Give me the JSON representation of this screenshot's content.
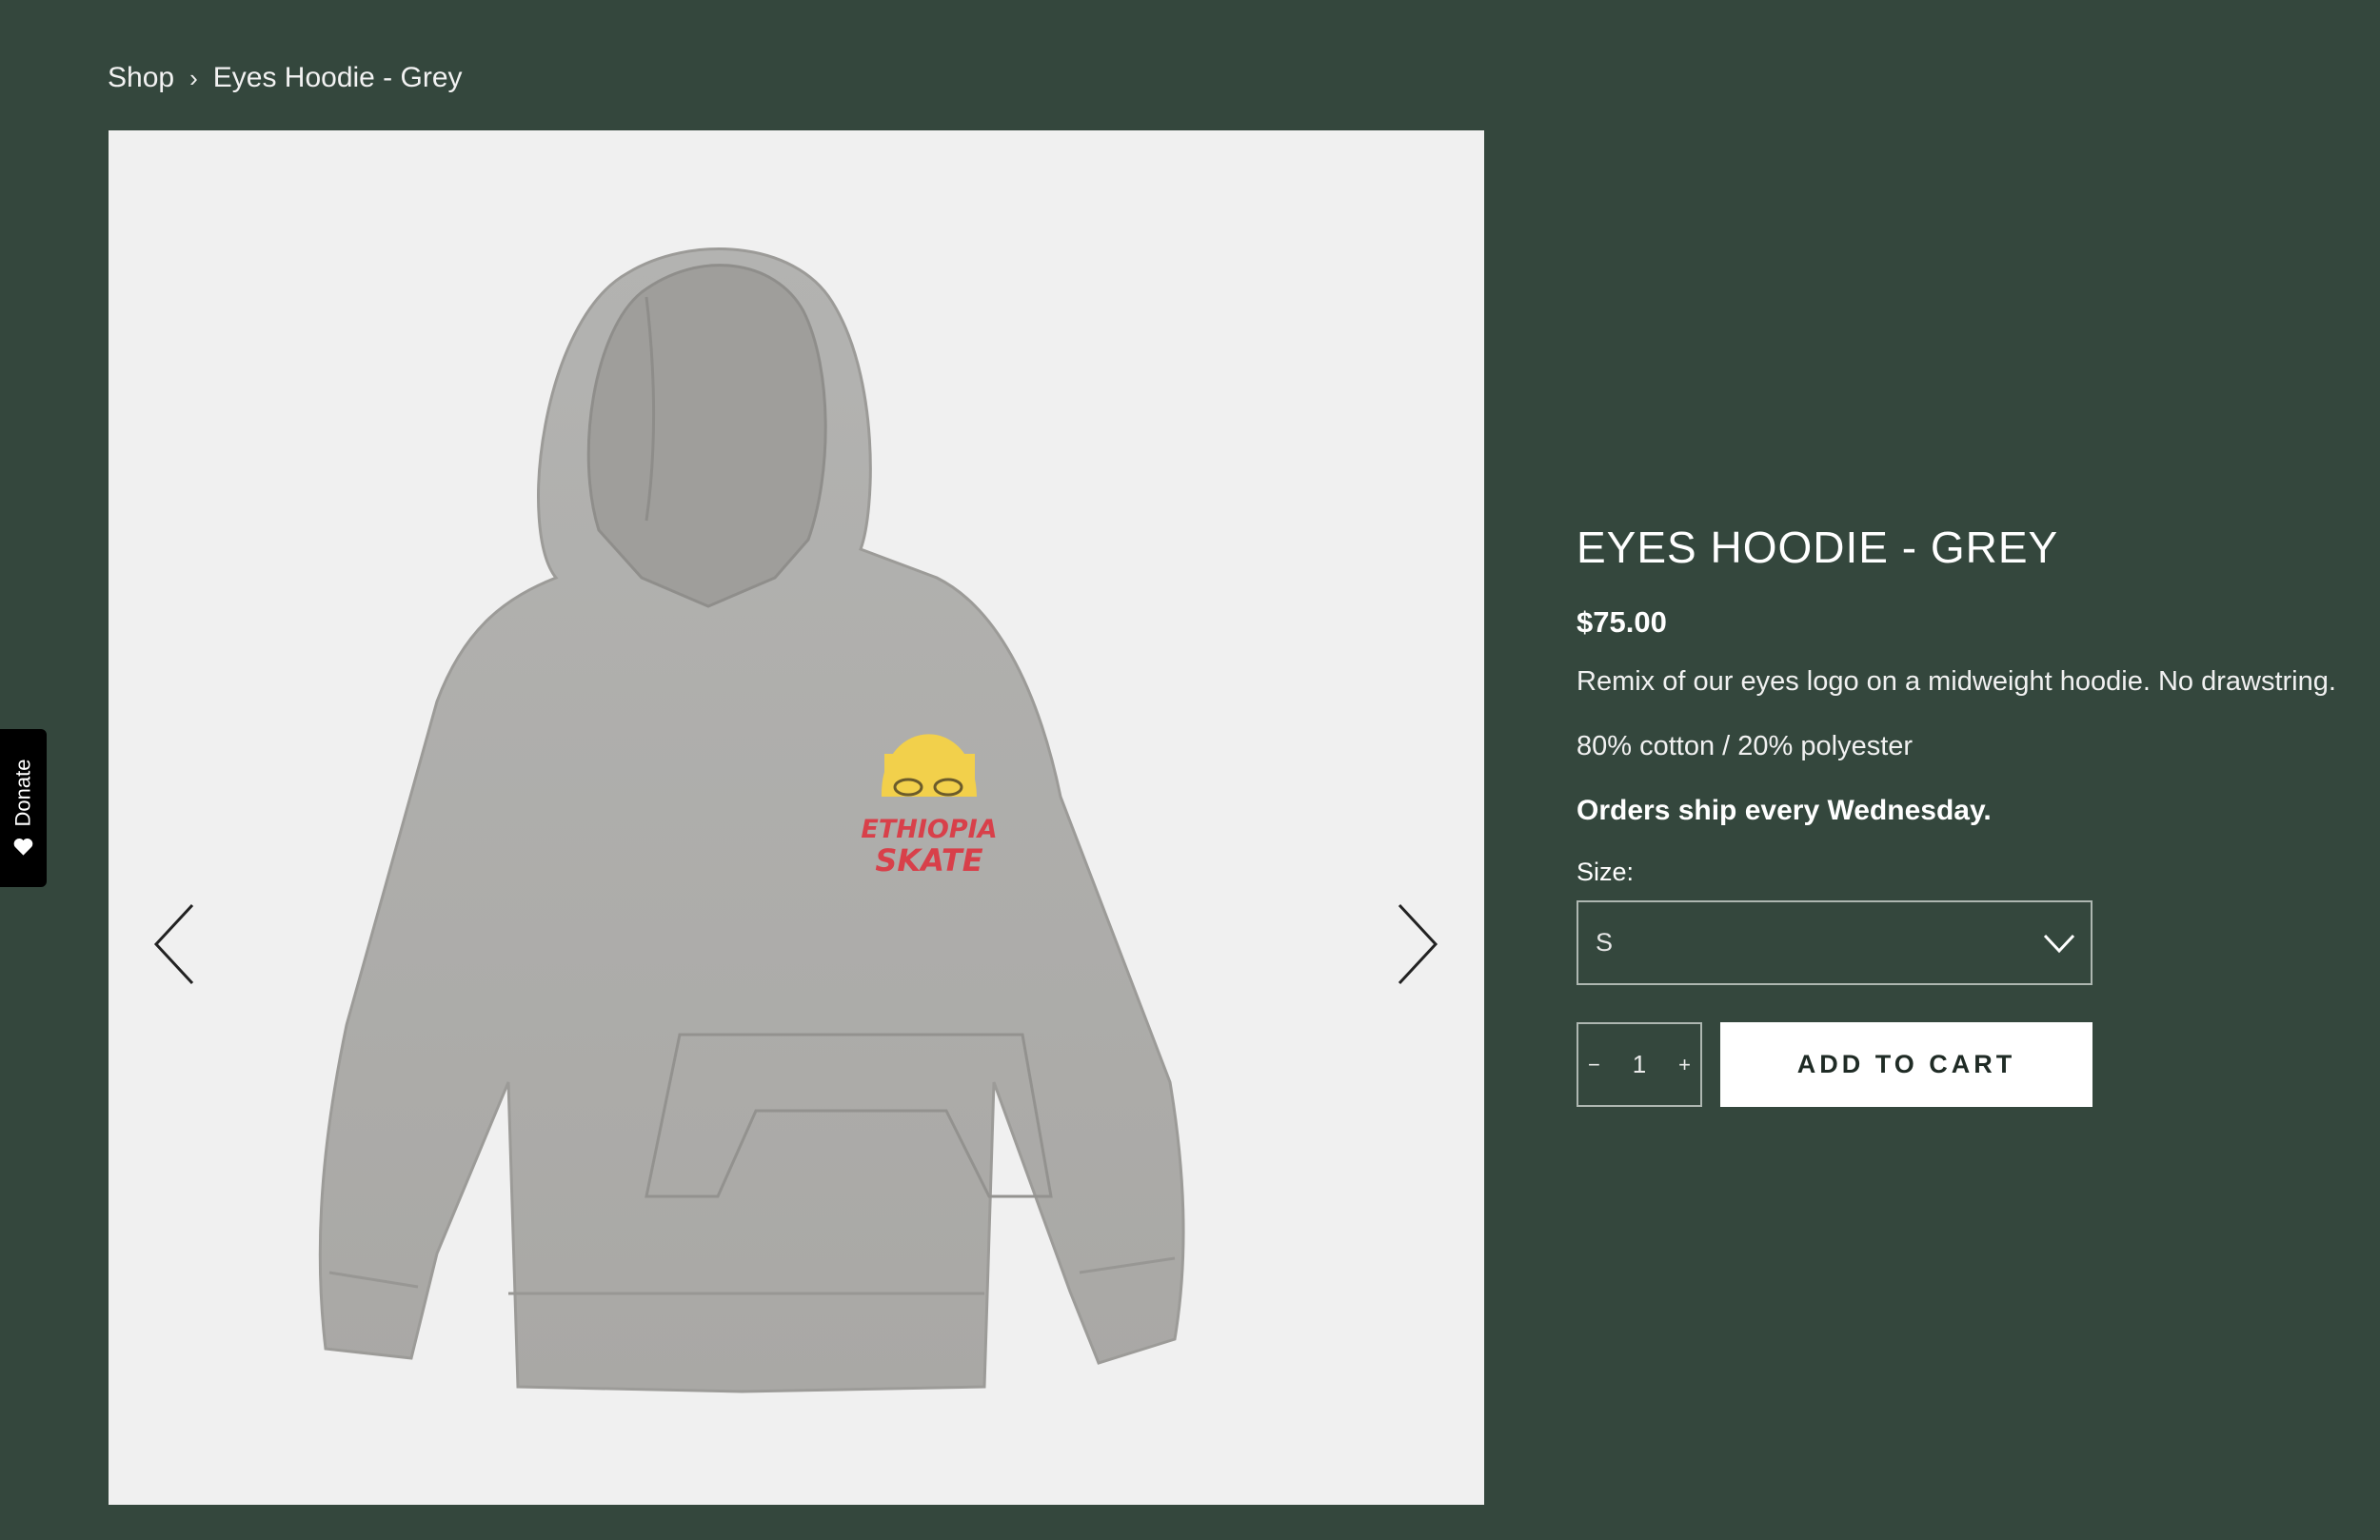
{
  "breadcrumb": {
    "shop": "Shop",
    "separator": "›",
    "current": "Eyes Hoodie - Grey"
  },
  "donate_tab": {
    "label": "Donate",
    "icon": "heart-icon"
  },
  "gallery": {
    "image_alt": "Grey hoodie with Ethiopia Skate eyes logo",
    "prev_icon": "chevron-left-icon",
    "next_icon": "chevron-right-icon",
    "logo_text_top": "ETHIOPIA",
    "logo_text_bottom": "SKATE"
  },
  "product": {
    "title": "EYES HOODIE - GREY",
    "price": "$75.00",
    "description": "Remix of our eyes logo on a midweight hoodie. No drawstring.",
    "material": "80% cotton / 20% polyester",
    "shipping_note": "Orders ship every Wednesday.",
    "size_label": "Size:",
    "size_selected": "S",
    "quantity": "1",
    "qty_minus": "−",
    "qty_plus": "+",
    "add_to_cart": "ADD TO CART"
  },
  "colors": {
    "background": "#34473d",
    "image_bg": "#f0f0f0",
    "button_bg": "#ffffff",
    "button_text": "#1f2b25",
    "logo_yellow": "#f2d04b",
    "logo_red": "#d8404a"
  }
}
